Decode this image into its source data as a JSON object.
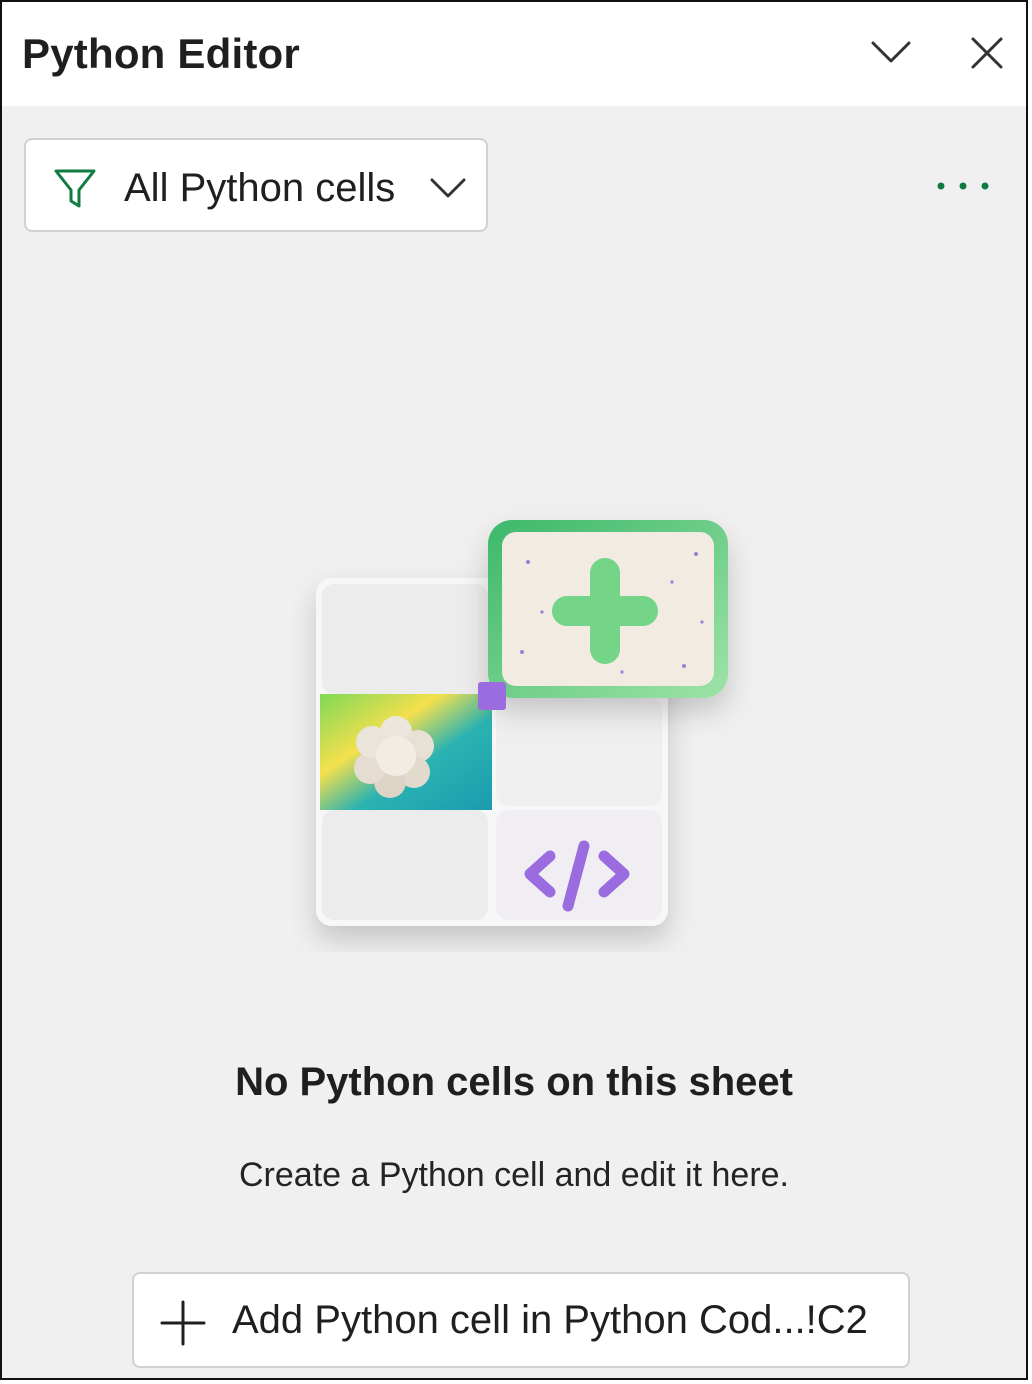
{
  "header": {
    "title": "Python Editor",
    "collapse_icon": "chevron-down-icon",
    "close_icon": "close-icon"
  },
  "toolbar": {
    "filter_label": "All Python cells",
    "filter_icon": "filter-icon",
    "more_icon": "more-options-icon"
  },
  "empty_state": {
    "title": "No Python cells on this sheet",
    "subtitle": "Create a Python cell and edit it here."
  },
  "add_button": {
    "label": "Add Python cell in Python Cod...!C2",
    "icon": "plus-icon"
  },
  "colors": {
    "accent_green": "#107c41",
    "panel_bg": "#f0f0f0",
    "illustration_purple": "#9b6be0",
    "illustration_green": "#6fd08a"
  }
}
